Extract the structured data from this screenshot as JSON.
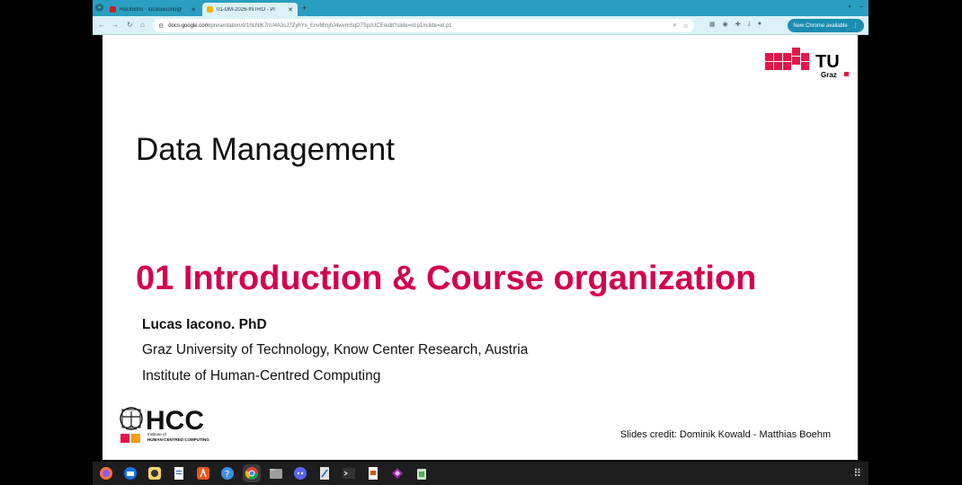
{
  "browser": {
    "tabs": [
      {
        "title": "Recibidos - lucasiacono@",
        "icon_color": "#c5221f",
        "active": false
      },
      {
        "title": "01-DM-2026-INTRO - Pr",
        "icon_color": "#f4b400",
        "active": true
      }
    ],
    "new_tab_label": "+",
    "url_host": "docs.google.com",
    "url_path": "/presentation/d/1hLNlK7riU4A3sJ7ZyhYx_EnvMmjhJ4wvmSqD7SpzUCE/edit?slide=id.p1#slide=id.p1",
    "update_button_label": "New Chrome available",
    "accent_color": "#2a9ec0"
  },
  "slide": {
    "deck_title": "Data Management",
    "lecture_title": "01 Introduction & Course organization",
    "author": "Lucas Iacono. PhD",
    "affiliation_1": "Graz University of Technology, Know Center Research, Austria",
    "affiliation_2": "Institute of Human-Centred Computing",
    "credits": "Slides credit: Dominik Kowald - Matthias Boehm",
    "tu_logo_text": "TU",
    "tu_logo_sub": "Graz",
    "hcc_logo_text": "HCC",
    "hcc_sub_1": "Institute of",
    "hcc_sub_2": "HUMAN-CENTRED COMPUTING",
    "accent_color": "#d4004f"
  },
  "dock": {
    "items": [
      "firefox-icon",
      "thunderbird-icon",
      "rhythmbox-icon",
      "writer-icon",
      "app-center-icon",
      "help-icon",
      "chrome-icon",
      "files-icon",
      "discord-icon",
      "text-editor-icon",
      "terminal-icon",
      "impress-icon",
      "vscode-icon",
      "trash-icon"
    ]
  }
}
